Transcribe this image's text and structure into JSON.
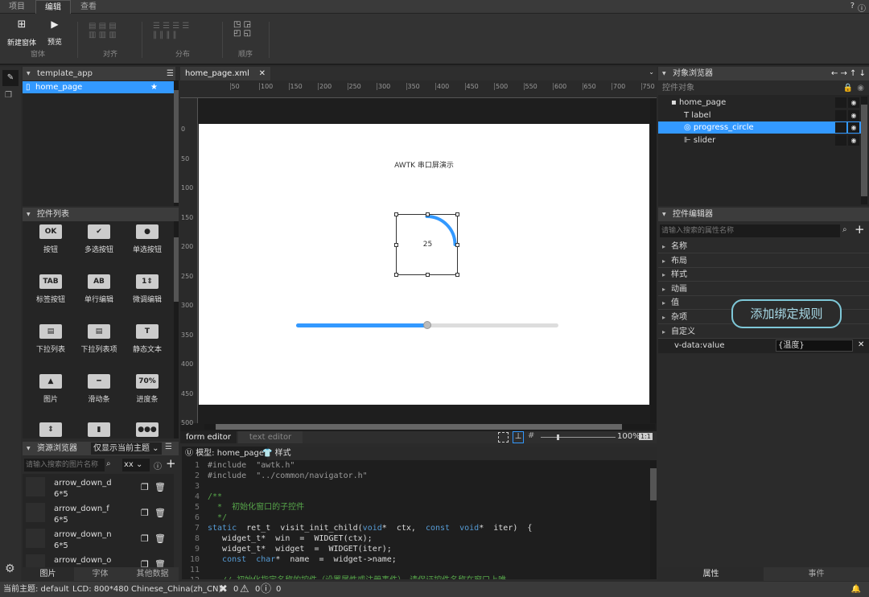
{
  "menu_tabs": [
    "项目",
    "编辑",
    "查看"
  ],
  "active_tab": 1,
  "ribbon": {
    "new_window": "新建窗体",
    "preview": "预览",
    "groups": [
      "窗体",
      "对齐",
      "分布",
      "顺序"
    ]
  },
  "project": {
    "title": "template_app",
    "file": "home_page"
  },
  "widget_list": {
    "title": "控件列表",
    "items": [
      "按钮",
      "多选按钮",
      "单选按钮",
      "标签按钮",
      "单行编辑",
      "微调编辑",
      "下拉列表",
      "下拉列表项",
      "静态文本",
      "图片",
      "滑动条",
      "进度条"
    ],
    "icons": [
      "OK",
      "✔",
      "●",
      "TAB",
      "AB",
      "1⇕",
      "▤",
      "▤",
      "T",
      "▲",
      "━",
      "70%"
    ],
    "progress_icon_label": "70%"
  },
  "resources": {
    "title": "资源浏览器",
    "filter": "仅显示当前主题",
    "search_placeholder": "请输入搜索的图片名称",
    "type": "xx",
    "items": [
      {
        "name": "arrow_down_d",
        "size": "6*5"
      },
      {
        "name": "arrow_down_f",
        "size": "6*5"
      },
      {
        "name": "arrow_down_n",
        "size": "6*5"
      },
      {
        "name": "arrow_down_o",
        "size": ""
      }
    ],
    "tabs": [
      "图片",
      "字体",
      "其他数据"
    ]
  },
  "editor": {
    "file_tab": "home_page.xml",
    "ruler_x": [
      "50",
      "100",
      "150",
      "200",
      "250",
      "300",
      "350",
      "400",
      "450",
      "500",
      "550",
      "600",
      "650",
      "700",
      "750"
    ],
    "ruler_y": [
      "0",
      "50",
      "100",
      "150",
      "200",
      "250",
      "300",
      "350",
      "400",
      "450",
      "500"
    ],
    "canvas_label": "AWTK 串口屏演示",
    "progress_value": "25",
    "progress": 25,
    "slider": 50,
    "mode_tabs": [
      "form editor",
      "text editor"
    ],
    "zoom": "100%",
    "one_to_one": "1:1"
  },
  "code": {
    "model_tab": "模型: home_page",
    "style_tab": "样式",
    "lines": [
      [
        [
          "pp",
          "#include  \"awtk.h\""
        ]
      ],
      [
        [
          "pp",
          "#include  \"../common/navigator.h\""
        ]
      ],
      [],
      [
        [
          "cm",
          "/**"
        ]
      ],
      [
        [
          "cm",
          "  *  初始化窗口的子控件"
        ]
      ],
      [
        [
          "cm",
          "  */"
        ]
      ],
      [
        [
          "kw",
          "static"
        ],
        [
          "tx",
          "  ret_t  visit_init_child("
        ],
        [
          "kw",
          "void"
        ],
        [
          "tx",
          "*  ctx,  "
        ],
        [
          "kw",
          "const"
        ],
        [
          "tx",
          "  "
        ],
        [
          "kw",
          "void"
        ],
        [
          "tx",
          "*  iter)  {"
        ]
      ],
      [
        [
          "tx",
          "   widget_t*  win  =  WIDGET(ctx);"
        ]
      ],
      [
        [
          "tx",
          "   widget_t*  widget  =  WIDGET(iter);"
        ]
      ],
      [
        [
          "kw",
          "   const"
        ],
        [
          "tx",
          "  "
        ],
        [
          "kw",
          "char"
        ],
        [
          "tx",
          "*  name  =  widget->name;"
        ]
      ],
      [],
      [
        [
          "cm",
          "   // 初始化指定名称的控件（设置属性或注册事件），请保证控件名称在窗口上唯"
        ]
      ]
    ]
  },
  "object_browser": {
    "title": "对象浏览器",
    "subtitle": "控件对象",
    "nodes": [
      "home_page",
      "label",
      "progress_circle",
      "slider"
    ],
    "selected": 2
  },
  "prop_editor": {
    "title": "控件编辑器",
    "search_placeholder": "请输入搜索的属性名称",
    "groups": [
      "名称",
      "布局",
      "样式",
      "动画",
      "值",
      "杂项",
      "自定义"
    ],
    "custom": {
      "key": "v-data:value",
      "value": "{温度}"
    },
    "callout": "添加绑定规则",
    "tabs": [
      "属性",
      "事件"
    ]
  },
  "status": {
    "theme": "当前主题: default",
    "lcd": "LCD: 800*480",
    "lang": "Chinese_China(zh_CN)",
    "errors": "0",
    "warnings": "0",
    "infos": "0"
  },
  "colors": {
    "accent": "#3399ff",
    "selection": "#3a8ee6",
    "callout": "#7ec8d8"
  }
}
